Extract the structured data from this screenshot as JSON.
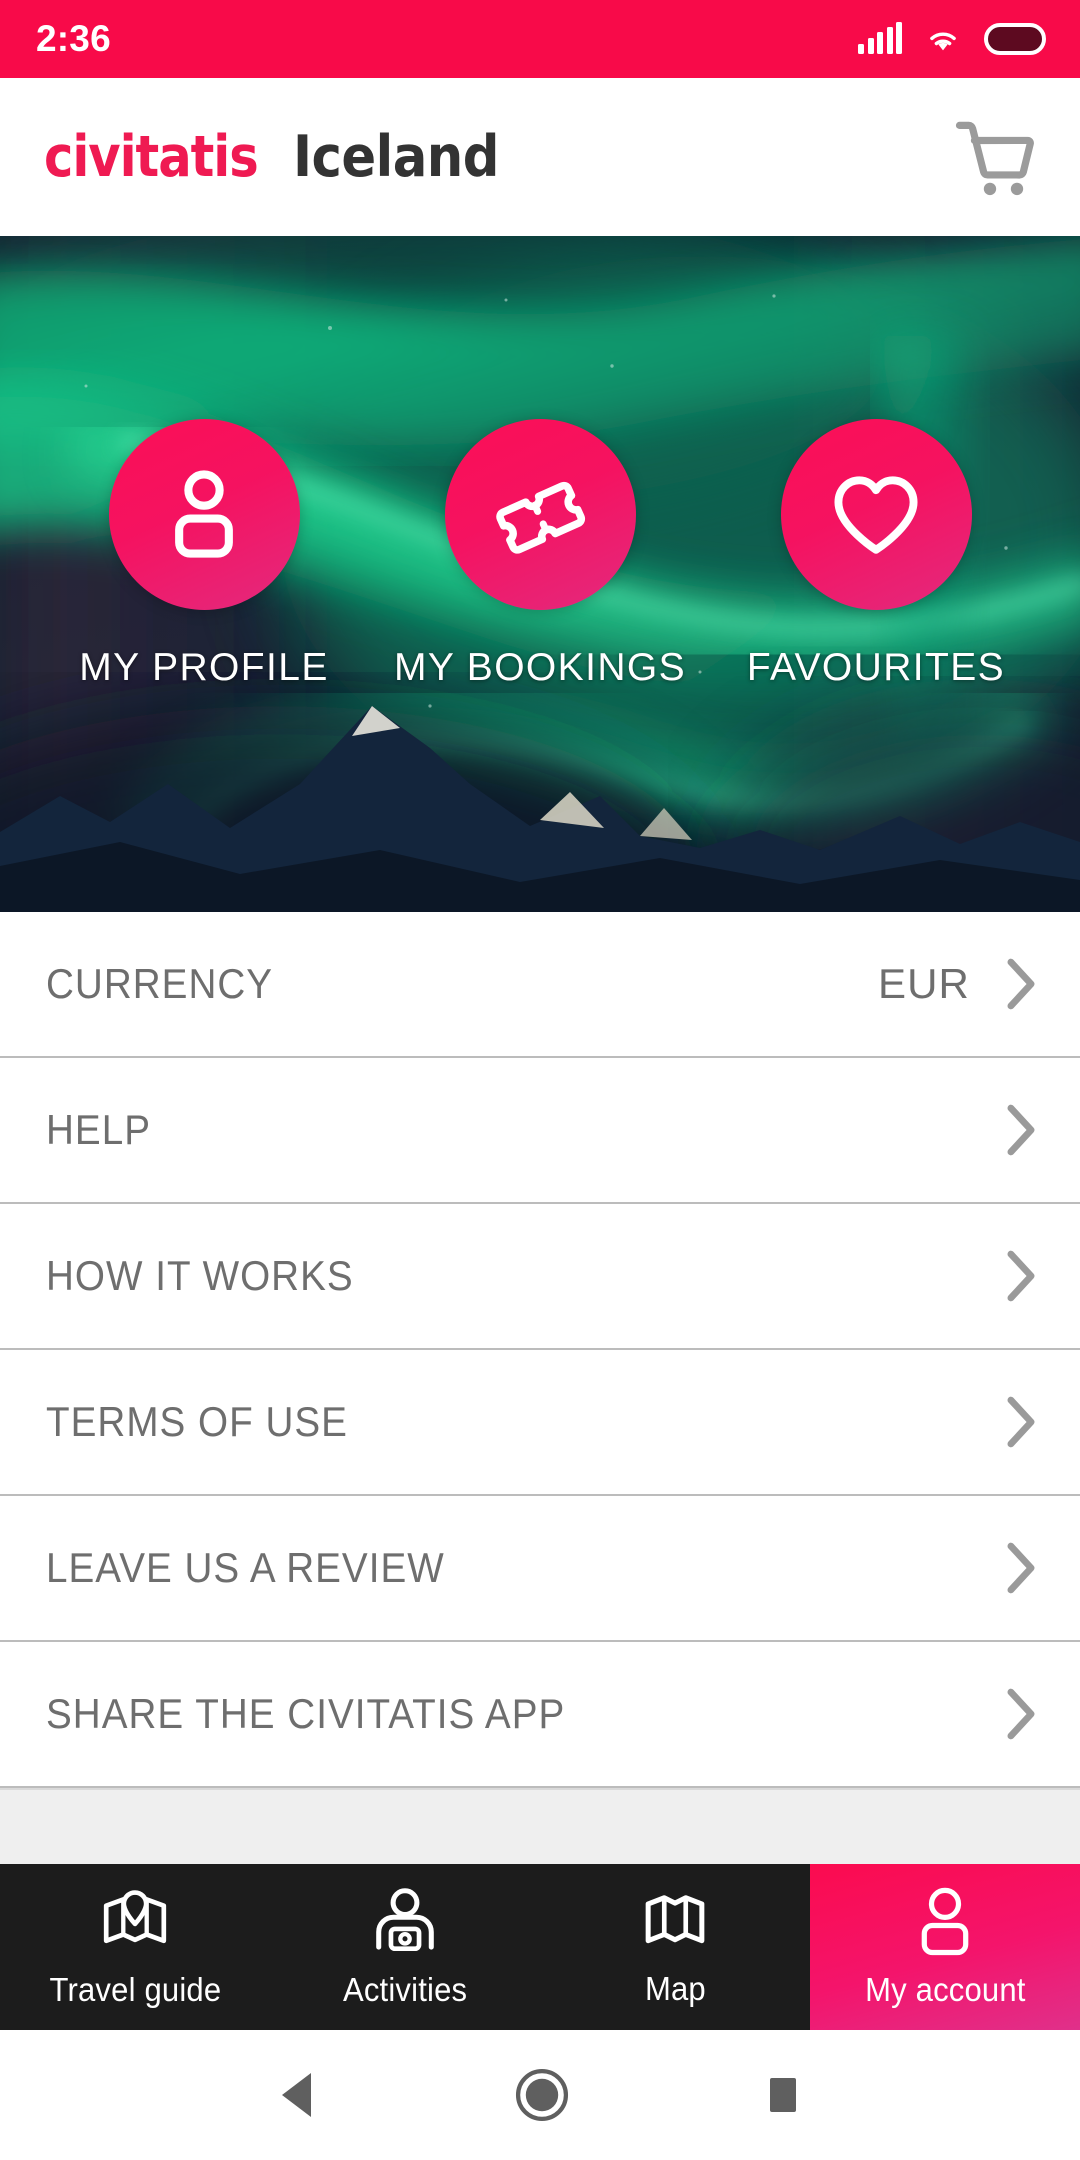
{
  "status_bar": {
    "time": "2:36",
    "icons": [
      "signal-bars-icon",
      "wifi-icon",
      "battery-icon"
    ],
    "background_color": "#f80a49"
  },
  "header": {
    "brand": "civitatis",
    "destination": "Iceland",
    "brand_color": "#ef1a52",
    "destination_color": "#333333",
    "cart_icon": "shopping-cart-icon"
  },
  "hero": {
    "background_description": "aurora-borealis-iceland-photo",
    "actions": [
      {
        "label": "MY PROFILE",
        "icon": "person-icon"
      },
      {
        "label": "MY BOOKINGS",
        "icon": "ticket-icon"
      },
      {
        "label": "FAVOURITES",
        "icon": "heart-icon"
      }
    ],
    "accent_color": "#fb0f56"
  },
  "menu": {
    "items": [
      {
        "label": "CURRENCY",
        "value": "EUR",
        "chevron": "chevron-right-icon"
      },
      {
        "label": "HELP",
        "value": "",
        "chevron": "chevron-right-icon"
      },
      {
        "label": "HOW IT WORKS",
        "value": "",
        "chevron": "chevron-right-icon"
      },
      {
        "label": "TERMS OF USE",
        "value": "",
        "chevron": "chevron-right-icon"
      },
      {
        "label": "LEAVE US A REVIEW",
        "value": "",
        "chevron": "chevron-right-icon"
      },
      {
        "label": "SHARE THE CIVITATIS APP",
        "value": "",
        "chevron": "chevron-right-icon"
      }
    ]
  },
  "bottom_nav": {
    "items": [
      {
        "label": "Travel guide",
        "icon": "map-pin-guide-icon",
        "active": false
      },
      {
        "label": "Activities",
        "icon": "tourist-camera-icon",
        "active": false
      },
      {
        "label": "Map",
        "icon": "folded-map-icon",
        "active": false
      },
      {
        "label": "My account",
        "icon": "person-icon",
        "active": true
      }
    ],
    "active_color": "#fb0b4f",
    "background_color": "#1c1c1c"
  },
  "android_nav": {
    "buttons": [
      "back-icon",
      "home-icon",
      "recents-icon"
    ]
  }
}
